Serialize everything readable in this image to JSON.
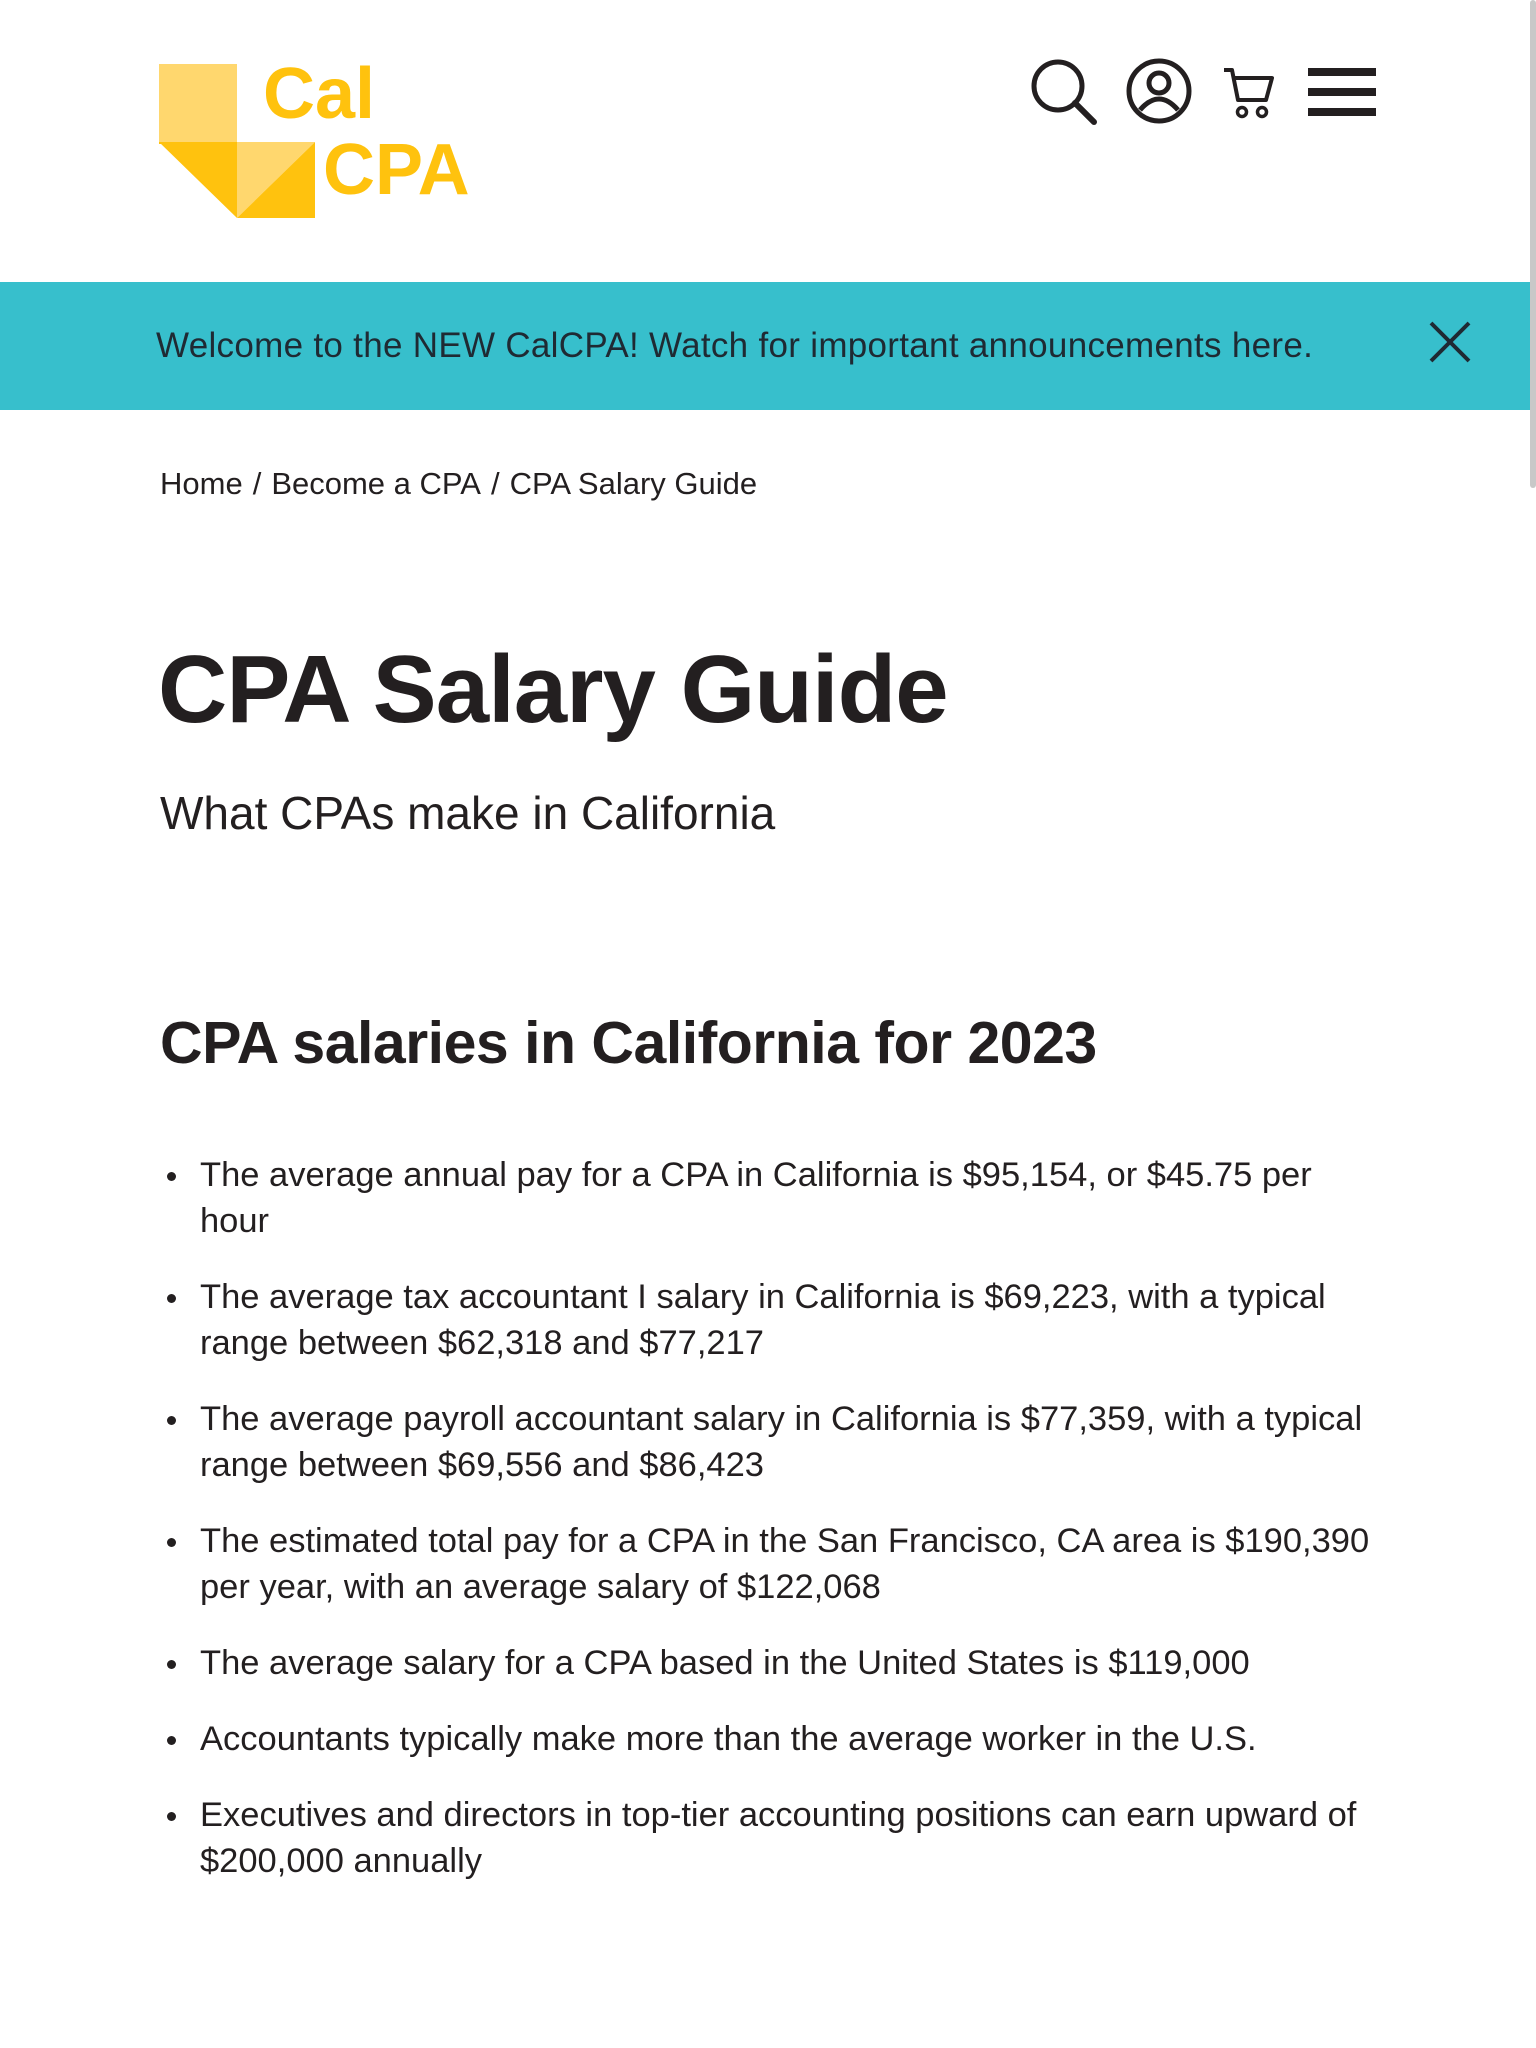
{
  "brand": {
    "name_line1": "Cal",
    "name_line2": "CPA",
    "colors": {
      "gold": "#ffc20e",
      "gold_light": "#ffd76e",
      "teal": "#37bfcc",
      "text": "#231f20"
    }
  },
  "header": {
    "icons": [
      "search-icon",
      "account-icon",
      "cart-icon",
      "menu-icon"
    ]
  },
  "announcement": {
    "text": "Welcome to the NEW CalCPA! Watch for important announcements here.",
    "close_icon": "close-icon"
  },
  "breadcrumb": {
    "items": [
      "Home",
      "Become a CPA",
      "CPA Salary Guide"
    ],
    "separator": "/"
  },
  "page": {
    "title": "CPA Salary Guide",
    "subtitle": "What CPAs make in California"
  },
  "section": {
    "title": "CPA salaries in California for 2023",
    "bullets": [
      "The average annual pay for a CPA in California is $95,154, or $45.75 per hour",
      "The average tax accountant I salary in California is $69,223, with a typical range between $62,318 and $77,217",
      "The average payroll accountant salary in California is $77,359, with a typical range between $69,556 and $86,423",
      "The estimated total pay for a CPA in the San Francisco, CA area is $190,390 per year, with an average salary of $122,068",
      "The average salary for a CPA based in the United States is $119,000",
      "Accountants typically make more than the average worker in the U.S.",
      "Executives and directors in top-tier accounting positions can earn upward of $200,000 annually"
    ]
  }
}
